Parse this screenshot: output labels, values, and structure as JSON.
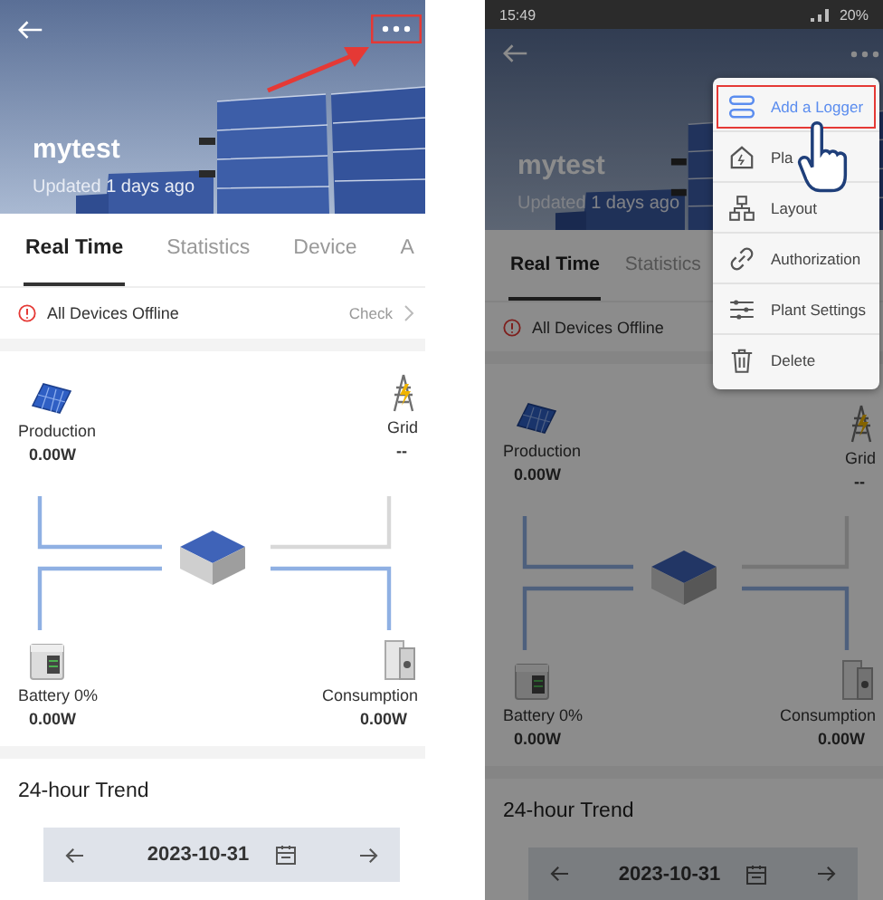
{
  "screens": [
    {
      "header": {
        "title": "mytest",
        "subtitle": "Updated 1 days ago"
      },
      "tabs": [
        {
          "label": "Real Time",
          "selected": true
        },
        {
          "label": "Statistics",
          "selected": false
        },
        {
          "label": "Device",
          "selected": false
        },
        {
          "label": "A",
          "selected": false
        }
      ],
      "alert": {
        "text": "All Devices Offline",
        "action": "Check"
      },
      "nodes": [
        {
          "kind": "production",
          "label": "Production",
          "value": "0.00W",
          "flow_active": true
        },
        {
          "kind": "grid",
          "label": "Grid",
          "value": "--",
          "flow_active": false
        },
        {
          "kind": "battery",
          "label": "Battery 0%",
          "value": "0.00W",
          "flow_active": true
        },
        {
          "kind": "consumption",
          "label": "Consumption",
          "value": "0.00W",
          "flow_active": true
        }
      ],
      "trend": {
        "title": "24-hour Trend",
        "date": "2023-10-31"
      }
    },
    {
      "status_bar": {
        "time": "15:49",
        "battery": "20%"
      },
      "header": {
        "title": "mytest",
        "subtitle": "Updated 1 days ago"
      },
      "tabs": [
        {
          "label": "Real Time",
          "selected": true
        },
        {
          "label": "Statistics",
          "selected": false
        }
      ],
      "alert": {
        "text": "All Devices Offline"
      },
      "nodes": [
        {
          "kind": "production",
          "label": "Production",
          "value": "0.00W",
          "flow_active": true
        },
        {
          "kind": "grid",
          "label": "Grid",
          "value": "--",
          "flow_active": false
        },
        {
          "kind": "battery",
          "label": "Battery 0%",
          "value": "0.00W",
          "flow_active": true
        },
        {
          "kind": "consumption",
          "label": "Consumption",
          "value": "0.00W",
          "flow_active": true
        }
      ],
      "trend": {
        "title": "24-hour Trend",
        "date": "2023-10-31"
      },
      "menu": [
        {
          "label": "Add a Logger",
          "highlighted": true
        },
        {
          "label": "Pla",
          "highlighted": false
        },
        {
          "label": "Layout",
          "highlighted": false
        },
        {
          "label": "Authorization",
          "highlighted": false
        },
        {
          "label": "Plant Settings",
          "highlighted": false
        },
        {
          "label": "Delete",
          "highlighted": false
        }
      ]
    }
  ]
}
